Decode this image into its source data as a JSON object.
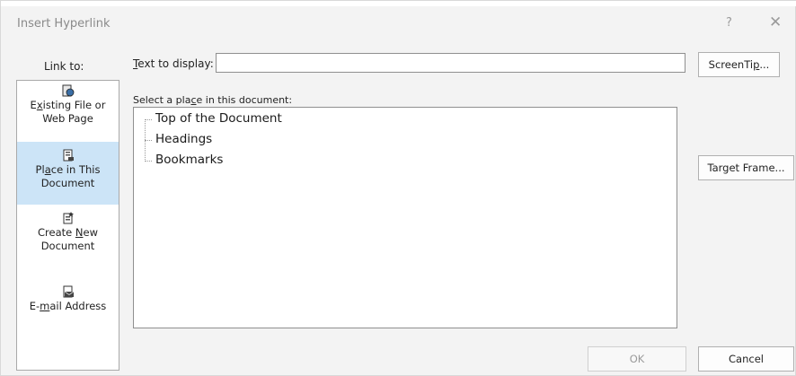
{
  "dialog": {
    "title": "Insert Hyperlink",
    "help_icon": "help-icon",
    "close_icon": "close-icon",
    "help_glyph": "?",
    "close_glyph": "✕"
  },
  "link_to": {
    "label": "Link to:",
    "items": [
      {
        "pre": "E",
        "ul": "x",
        "post": "isting File or",
        "line2": "Web Page",
        "icon": "globe-file-icon",
        "selected": false
      },
      {
        "pre": "Pl",
        "ul": "a",
        "post": "ce in This",
        "line2": "Document",
        "icon": "document-place-icon",
        "selected": true
      },
      {
        "pre": "Create ",
        "ul": "N",
        "post": "ew",
        "line2": "Document",
        "icon": "new-document-icon",
        "selected": false
      },
      {
        "pre": "E-",
        "ul": "m",
        "post": "ail Address",
        "line2": "",
        "icon": "email-icon",
        "selected": false
      }
    ]
  },
  "text_to_display": {
    "label_ul": "T",
    "label_rest": "ext to display:",
    "value": ""
  },
  "buttons": {
    "screentip_pre": "ScreenTi",
    "screentip_ul": "p",
    "screentip_post": "...",
    "target_frame": "Target Frame...",
    "ok": "OK",
    "cancel": "Cancel"
  },
  "place": {
    "label_pre": "Select a pla",
    "label_ul": "c",
    "label_post": "e in this document:",
    "tree": [
      "Top of the Document",
      "Headings",
      "Bookmarks"
    ]
  },
  "colors": {
    "selected_bg": "#cce4f7",
    "dialog_bg": "#f3f3f3"
  }
}
